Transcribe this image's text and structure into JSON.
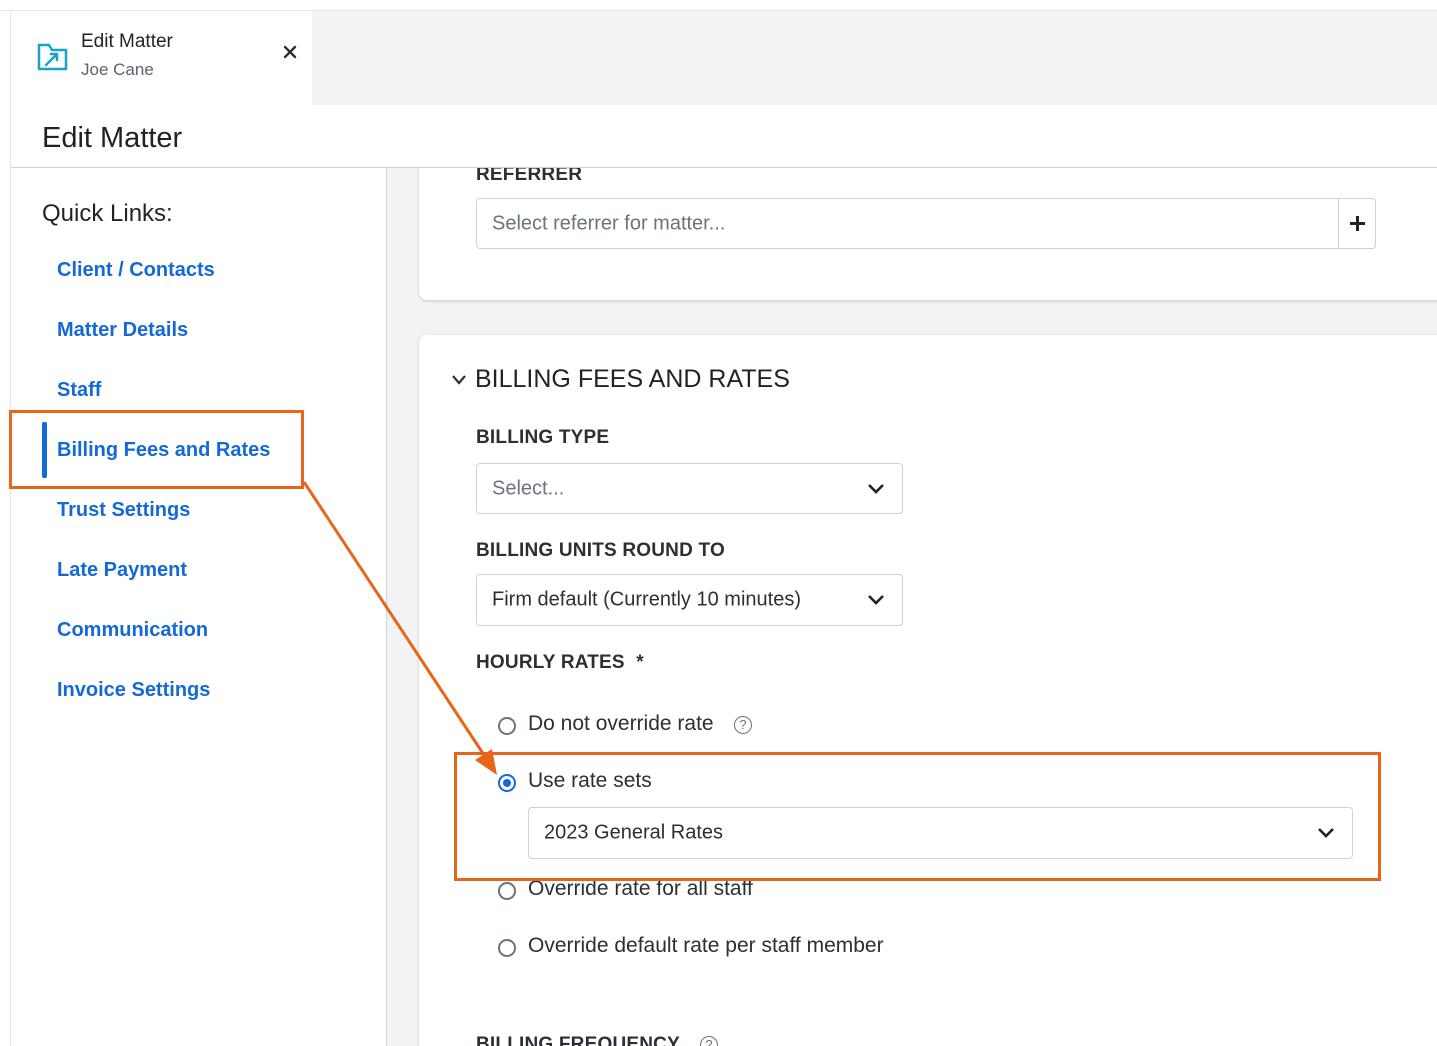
{
  "tab": {
    "title": "Edit Matter",
    "subtitle": "Joe Cane",
    "icon": "folder-link-icon",
    "close_icon": "close-icon"
  },
  "page": {
    "title": "Edit Matter"
  },
  "sidebar": {
    "heading": "Quick Links:",
    "active": "Billing Fees and Rates",
    "items": [
      {
        "label": "Client / Contacts"
      },
      {
        "label": "Matter Details"
      },
      {
        "label": "Staff"
      },
      {
        "label": "Billing Fees and Rates"
      },
      {
        "label": "Trust Settings"
      },
      {
        "label": "Late Payment"
      },
      {
        "label": "Communication"
      },
      {
        "label": "Invoice Settings"
      }
    ]
  },
  "referrer": {
    "label": "REFERRER",
    "placeholder": "Select referrer for matter...",
    "add_icon": "plus-icon"
  },
  "billing": {
    "section_title": "BILLING FEES AND RATES",
    "billing_type": {
      "label": "BILLING TYPE",
      "placeholder": "Select..."
    },
    "units_round": {
      "label": "BILLING UNITS ROUND TO",
      "value": "Firm default (Currently 10 minutes)"
    },
    "hourly_rates": {
      "label": "HOURLY RATES",
      "required_mark": "*",
      "options": [
        {
          "label": "Do not override rate",
          "selected": false
        },
        {
          "label": "Use rate sets",
          "selected": true
        },
        {
          "label": "Override rate for all staff",
          "selected": false
        },
        {
          "label": "Override default rate per staff member",
          "selected": false
        }
      ],
      "rate_set_value": "2023 General Rates"
    },
    "frequency_label": "BILLING FREQUENCY"
  },
  "colors": {
    "link": "#1469d8",
    "highlight": "#e8651a",
    "background": "#f3f3f6"
  }
}
